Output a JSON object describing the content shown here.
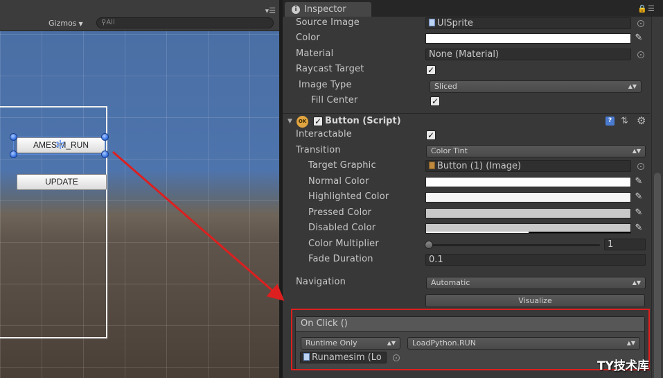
{
  "scene": {
    "gizmos_label": "Gizmos",
    "search_placeholder": "All",
    "run_button": "AMESIM_RUN",
    "update_button": "UPDATE"
  },
  "inspector": {
    "tab_label": "Inspector",
    "image": {
      "source_image_label": "Source Image",
      "source_image_value": "UISprite",
      "color_label": "Color",
      "material_label": "Material",
      "material_value": "None (Material)",
      "raycast_target_label": "Raycast Target",
      "image_type_label": "Image Type",
      "image_type_value": "Sliced",
      "fill_center_label": "Fill Center"
    },
    "button": {
      "title": "Button (Script)",
      "icon_text": "OK",
      "interactable_label": "Interactable",
      "transition_label": "Transition",
      "transition_value": "Color Tint",
      "target_graphic_label": "Target Graphic",
      "target_graphic_value": "Button (1) (Image)",
      "normal_color_label": "Normal Color",
      "highlighted_color_label": "Highlighted Color",
      "pressed_color_label": "Pressed Color",
      "disabled_color_label": "Disabled Color",
      "color_multiplier_label": "Color Multiplier",
      "color_multiplier_value": "1",
      "fade_duration_label": "Fade Duration",
      "fade_duration_value": "0.1",
      "navigation_label": "Navigation",
      "navigation_value": "Automatic",
      "visualize_label": "Visualize"
    },
    "on_click": {
      "header": "On Click ()",
      "runtime_value": "Runtime Only",
      "function_value": "LoadPython.RUN",
      "object_value": "Runamesim (Lo"
    }
  },
  "watermark": "TY技术库",
  "colors": {
    "highlight_red": "#dd1f1f",
    "normal_color": "#ffffff",
    "highlighted_color": "#f5f5f5",
    "pressed_color": "#c8c8c8",
    "disabled_color": "#c8c8c8"
  }
}
